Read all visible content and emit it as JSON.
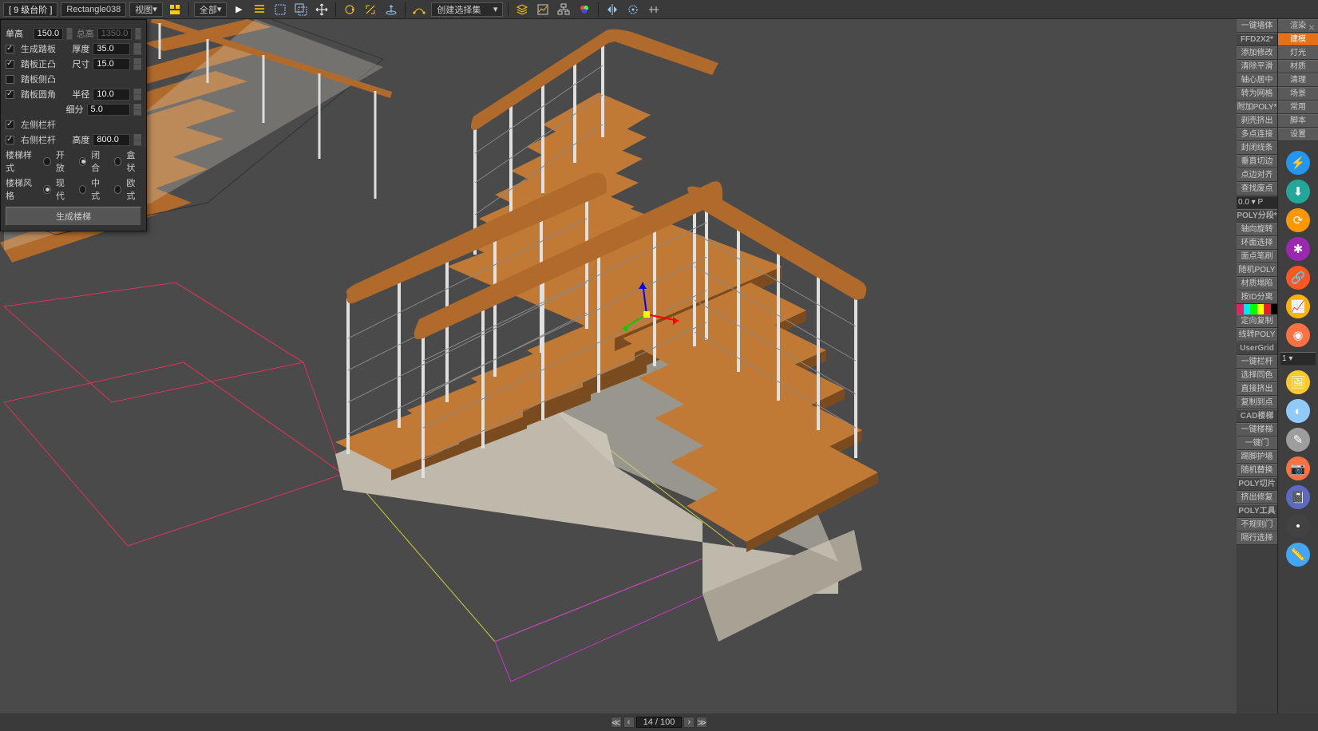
{
  "topbar": {
    "steps": "[ 9 级台阶 ]",
    "object": "Rectangle038",
    "view": "视图",
    "filter": "全部",
    "createSel": "创建选择集"
  },
  "floating": {
    "h_single_lbl": "单高",
    "h_single": "150.0",
    "h_total_lbl": "总高",
    "h_total": "1350.0",
    "gen_kick": "生成踏板",
    "thick_lbl": "厚度",
    "thick": "35.0",
    "kick_front": "踏板正凸",
    "size_lbl": "尺寸",
    "size": "15.0",
    "kick_side": "踏板侧凸",
    "kick_corner": "踏板圆角",
    "rad_lbl": "半径",
    "rad": "10.0",
    "subdiv_lbl": "细分",
    "subdiv": "5.0",
    "rail_l": "左侧栏杆",
    "rail_r": "右侧栏杆",
    "height_lbl": "高度",
    "height": "800.0",
    "style_lbl": "楼梯样式",
    "s1": "开放",
    "s2": "闭合",
    "s3": "盒状",
    "type_lbl": "楼梯风格",
    "t1": "现代",
    "t2": "中式",
    "t3": "欧式",
    "generate": "生成楼梯"
  },
  "status": {
    "page": "14 / 100"
  },
  "right_left": [
    {
      "t": "一键墙体"
    },
    {
      "t": "FFD2X2*",
      "cls": "header"
    },
    {
      "t": "添加修改"
    },
    {
      "t": "清除平滑"
    },
    {
      "t": "轴心居中"
    },
    {
      "t": "转为网格"
    },
    {
      "t": "附加POLY*"
    },
    {
      "t": "剥壳挤出"
    },
    {
      "t": "多点连接"
    },
    {
      "t": "封闭线条"
    },
    {
      "t": "垂直切边"
    },
    {
      "t": "点边对齐"
    },
    {
      "t": "查找废点"
    },
    {
      "t": "0.0    ▾  P",
      "cls": "num"
    },
    {
      "t": "POLY分段*",
      "cls": "header"
    },
    {
      "t": "轴向旋转"
    },
    {
      "t": "环面选择"
    },
    {
      "t": "面点笔刷"
    },
    {
      "t": "随机POLY"
    },
    {
      "t": "材质塌陷"
    },
    {
      "t": "按ID分离"
    },
    {
      "t": "__COLORBAR__"
    },
    {
      "t": "定向复制"
    },
    {
      "t": "线转POLY"
    },
    {
      "t": "UserGrid",
      "cls": "header"
    },
    {
      "t": "一键栏杆"
    },
    {
      "t": "选择同色"
    },
    {
      "t": "直接挤出"
    },
    {
      "t": "复制到点"
    },
    {
      "t": "CAD楼梯",
      "cls": "header"
    },
    {
      "t": "一键楼梯"
    },
    {
      "t": "一键门"
    },
    {
      "t": "踢脚护墙"
    },
    {
      "t": "随机替换"
    },
    {
      "t": "POLY切片",
      "cls": "header"
    },
    {
      "t": "挤出修复"
    },
    {
      "t": "POLY工具",
      "cls": "header"
    },
    {
      "t": "不规则门"
    },
    {
      "t": "隔行选择"
    }
  ],
  "right_right_top": [
    {
      "t": "渲染"
    },
    {
      "t": "建模",
      "cls": "active"
    },
    {
      "t": "灯光"
    },
    {
      "t": "材质"
    },
    {
      "t": "清理"
    },
    {
      "t": "场景"
    },
    {
      "t": "常用"
    },
    {
      "t": "脚本"
    },
    {
      "t": "设置"
    }
  ],
  "circles": [
    {
      "bg": "#2196f3",
      "g": "⚡"
    },
    {
      "bg": "#26a69a",
      "g": "⬇"
    },
    {
      "bg": "#ff9800",
      "g": "⟳"
    },
    {
      "bg": "#9c27b0",
      "g": "✱"
    },
    {
      "bg": "#ff5722",
      "g": "🔗"
    },
    {
      "bg": "#ffb300",
      "g": "📈"
    },
    {
      "bg": "#ff7043",
      "g": "◉"
    },
    {
      "bg": "__NUM__"
    },
    {
      "bg": "#ffca28",
      "g": "🖼"
    },
    {
      "bg": "#90caf9",
      "g": "◐"
    },
    {
      "bg": "#9e9e9e",
      "g": "✎"
    },
    {
      "bg": "#ff7043",
      "g": "📷"
    },
    {
      "bg": "#5c6bc0",
      "g": "📓"
    },
    {
      "bg": "#424242",
      "g": "•"
    },
    {
      "bg": "#42a5f5",
      "g": "📏"
    }
  ],
  "num_right": "1    ▾"
}
